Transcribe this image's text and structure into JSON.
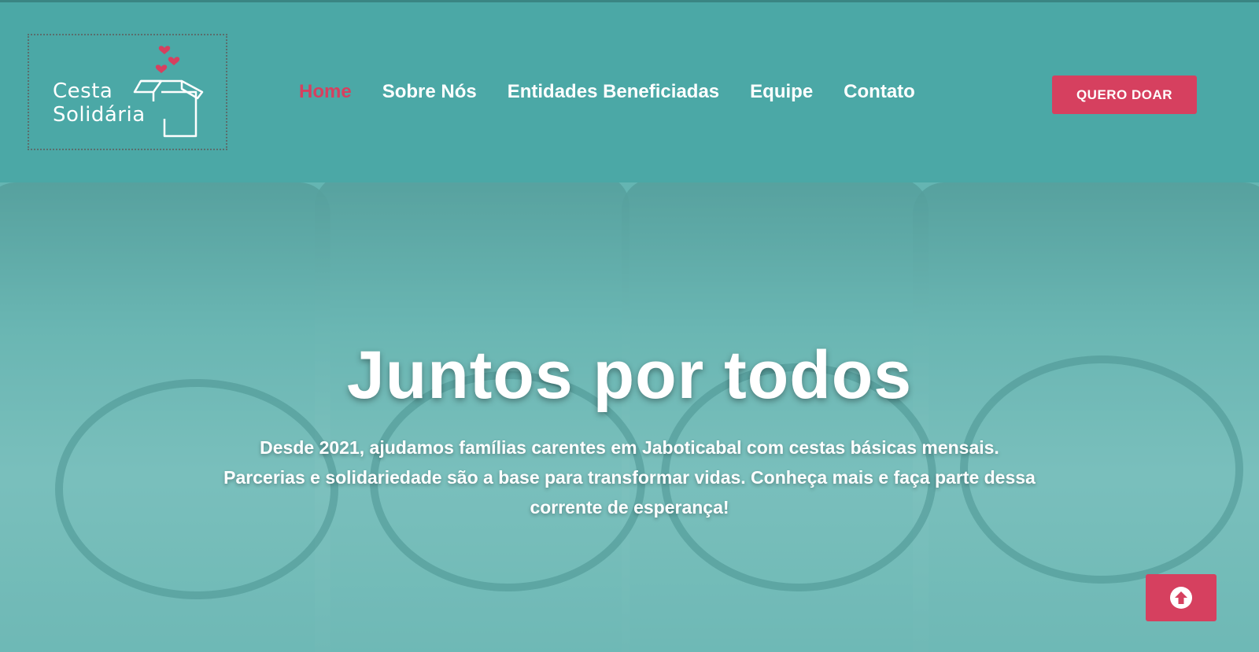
{
  "logo": {
    "line1": "Cesta",
    "line2": "Solidária",
    "icon": "gift-box-hearts-icon"
  },
  "nav": {
    "items": [
      {
        "label": "Home",
        "active": true
      },
      {
        "label": "Sobre Nós",
        "active": false
      },
      {
        "label": "Entidades Beneficiadas",
        "active": false
      },
      {
        "label": "Equipe",
        "active": false
      },
      {
        "label": "Contato",
        "active": false
      }
    ]
  },
  "header": {
    "donate_label": "QUERO DOAR"
  },
  "hero": {
    "title": "Juntos por todos",
    "text_line1": "Desde 2021, ajudamos famílias carentes em Jaboticabal com cestas básicas mensais.",
    "text_line2": "Parcerias e solidariedade são a base para transformar vidas. Conheça mais e faça parte dessa",
    "text_line3": "corrente de esperança!"
  },
  "scroll_top": {
    "icon": "arrow-up-circle-icon"
  },
  "colors": {
    "teal": "#4ba8a6",
    "accent": "#d6405f",
    "text": "#ffffff"
  }
}
